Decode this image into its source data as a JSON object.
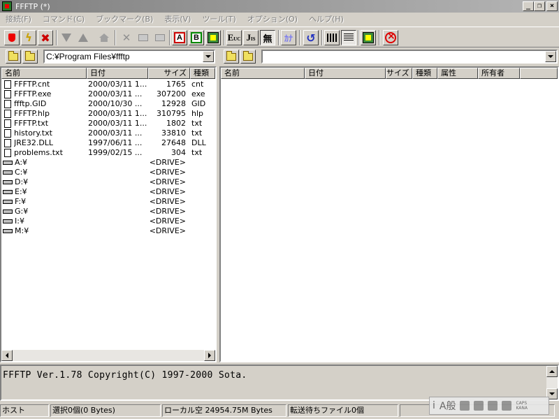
{
  "window": {
    "title": "FFFTP (*)",
    "minimize_label": "_",
    "maximize_label": "❐",
    "close_label": "×"
  },
  "menu": [
    "接続(F)",
    "コマンド(C)",
    "ブックマーク(B)",
    "表示(V)",
    "ツール(T)",
    "オプション(O)",
    "ヘルプ(H)"
  ],
  "toolbar": {
    "ascii_label": "A",
    "binary_label": "B",
    "euc_label": "E",
    "euc_sub": "UC",
    "jis_label": "J",
    "jis_sub": "IS",
    "no_convert_label": "無",
    "kana_label": "ｶﾅ"
  },
  "local": {
    "path": "C:¥Program Files¥ffftp",
    "columns": [
      "名前",
      "日付",
      "サイズ",
      "種類"
    ],
    "files": [
      {
        "name": "FFFTP.cnt",
        "date": "2000/03/11 1...",
        "size": "1765",
        "type": "cnt"
      },
      {
        "name": "FFFTP.exe",
        "date": "2000/03/11 ...",
        "size": "307200",
        "type": "exe"
      },
      {
        "name": "ffftp.GID",
        "date": "2000/10/30 ...",
        "size": "12928",
        "type": "GID"
      },
      {
        "name": "FFFTP.hlp",
        "date": "2000/03/11 1...",
        "size": "310795",
        "type": "hlp"
      },
      {
        "name": "FFFTP.txt",
        "date": "2000/03/11 1...",
        "size": "1802",
        "type": "txt"
      },
      {
        "name": "history.txt",
        "date": "2000/03/11 ...",
        "size": "33810",
        "type": "txt"
      },
      {
        "name": "JRE32.DLL",
        "date": "1997/06/11 ...",
        "size": "27648",
        "type": "DLL"
      },
      {
        "name": "problems.txt",
        "date": "1999/02/15 ...",
        "size": "304",
        "type": "txt"
      }
    ],
    "drives": [
      {
        "name": "A:¥",
        "size": "<DRIVE>"
      },
      {
        "name": "C:¥",
        "size": "<DRIVE>"
      },
      {
        "name": "D:¥",
        "size": "<DRIVE>"
      },
      {
        "name": "E:¥",
        "size": "<DRIVE>"
      },
      {
        "name": "F:¥",
        "size": "<DRIVE>"
      },
      {
        "name": "G:¥",
        "size": "<DRIVE>"
      },
      {
        "name": "I:¥",
        "size": "<DRIVE>"
      },
      {
        "name": "M:¥",
        "size": "<DRIVE>"
      }
    ]
  },
  "remote": {
    "path": "",
    "columns": [
      "名前",
      "日付",
      "サイズ",
      "種類",
      "属性",
      "所有者"
    ]
  },
  "log": {
    "text": "FFFTP Ver.1.78 Copyright(C) 1997-2000 Sota."
  },
  "status": {
    "host": "ホスト",
    "selection": "選択0個(0 Bytes)",
    "local_free": "ローカル空 24954.75M Bytes",
    "queue": "転送待ちファイル0個"
  },
  "ime": {
    "i": "i",
    "mode": "A般",
    "caps": "CAPS",
    "kana": "KANA"
  }
}
